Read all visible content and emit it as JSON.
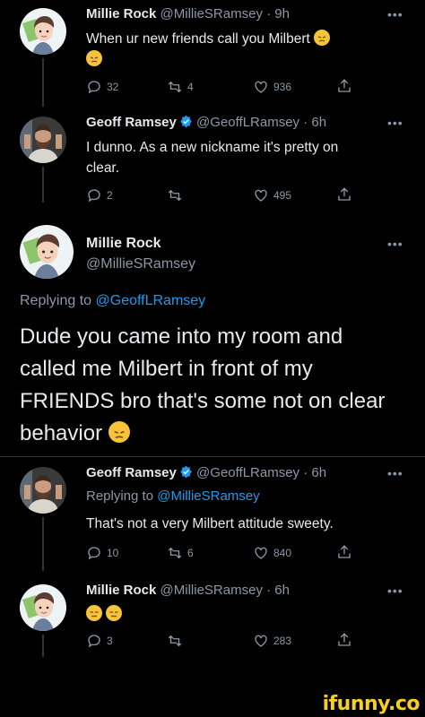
{
  "tweet1": {
    "name": "Millie Rock",
    "handle": "@MillieSRamsey",
    "time": "· 9h",
    "text": "When ur new friends call you Milbert",
    "replies": "32",
    "retweets": "4",
    "likes": "936"
  },
  "tweet2": {
    "name": "Geoff Ramsey",
    "handle": "@GeoffLRamsey",
    "time": "· 6h",
    "text_line1": "I dunno. As a new nickname it's pretty on",
    "text_line2": "clear.",
    "replies": "2",
    "retweets": "",
    "likes": "495"
  },
  "main": {
    "name": "Millie Rock",
    "handle": "@MillieSRamsey",
    "replying_prefix": "Replying to",
    "replying_handle": "@GeoffLRamsey",
    "line1": "Dude you came into my room and",
    "line2": "called me Milbert in front of my",
    "line3": "FRIENDS bro that's some not on clear",
    "line4": "behavior"
  },
  "tweet3": {
    "name": "Geoff Ramsey",
    "handle": "@GeoffLRamsey",
    "time": "· 6h",
    "replying_prefix": "Replying to",
    "replying_handle": "@MillieSRamsey",
    "text": "That's not a very Milbert attitude sweety.",
    "replies": "10",
    "retweets": "6",
    "likes": "840"
  },
  "tweet4": {
    "name": "Millie Rock",
    "handle": "@MillieSRamsey",
    "time": "· 6h",
    "replies": "3",
    "retweets": "",
    "likes": "283"
  },
  "footer": {
    "brand": "ifunny.co"
  },
  "icons": [
    "reply-icon",
    "retweet-icon",
    "like-icon",
    "share-icon",
    "verified-icon",
    "more-icon"
  ],
  "colors": {
    "background": "#000000",
    "text": "#e7e9ea",
    "muted": "#8b98a5",
    "link": "#1d9bf0",
    "verified": "#1d9bf0",
    "brand": "#f8cf1f"
  }
}
